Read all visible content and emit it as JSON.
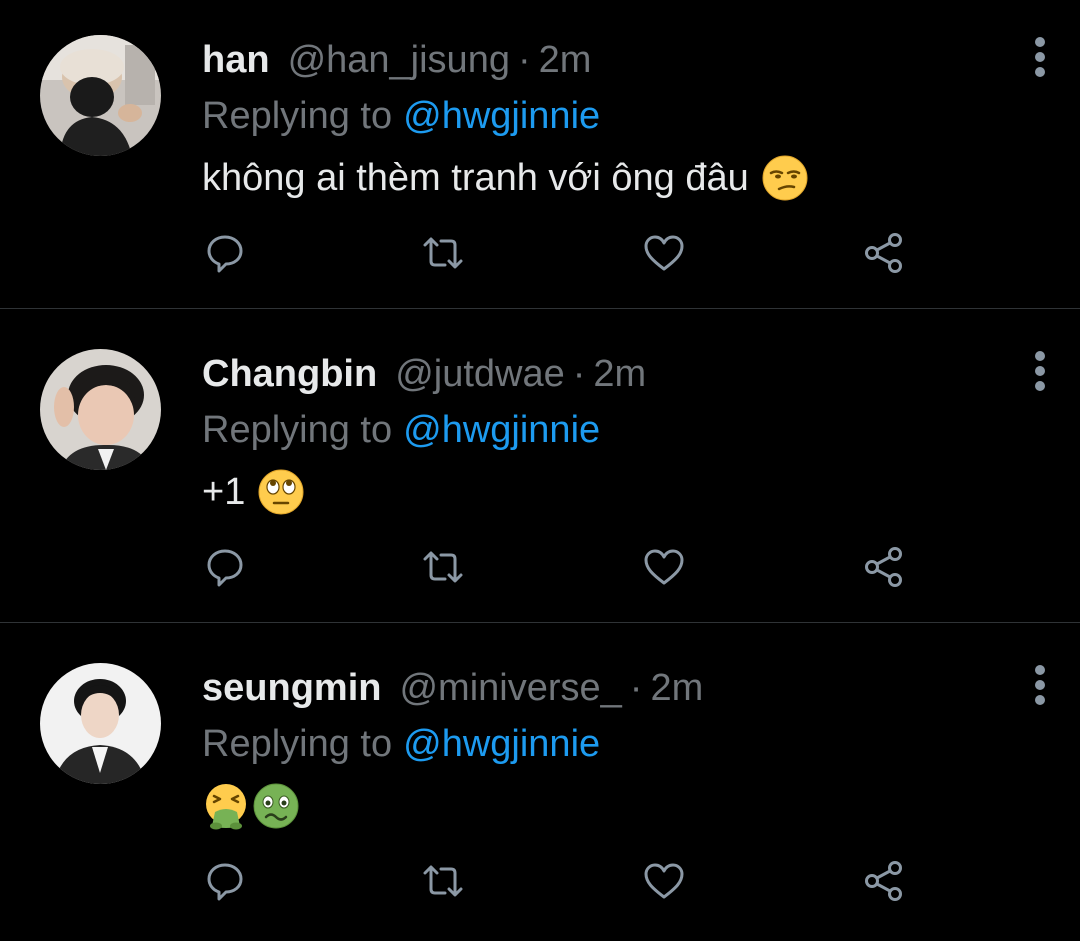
{
  "colors": {
    "background": "#000000",
    "divider": "#2f3336",
    "name": "#e7e9ea",
    "muted": "#71767b",
    "mention": "#1d9bf0",
    "icon": "#8b98a5"
  },
  "tweets": [
    {
      "name": "han",
      "handle": "@han_jisung",
      "separator": "·",
      "time": "2m",
      "reply_prefix": "Replying to",
      "reply_mention": "@hwgjinnie",
      "text": "không ai thèm tranh với ông đâu",
      "emojis": [
        "unamused-face-emoji"
      ],
      "avatar": "avatar-photo-masked-person"
    },
    {
      "name": "Changbin",
      "handle": "@jutdwae",
      "separator": "·",
      "time": "2m",
      "reply_prefix": "Replying to",
      "reply_mention": "@hwgjinnie",
      "text": "+1",
      "emojis": [
        "face-with-rolling-eyes-emoji"
      ],
      "avatar": "avatar-photo-peace-sign"
    },
    {
      "name": "seungmin",
      "handle": "@miniverse_",
      "separator": "·",
      "time": "2m",
      "reply_prefix": "Replying to",
      "reply_mention": "@hwgjinnie",
      "text": "",
      "emojis": [
        "face-vomiting-emoji",
        "nauseated-face-emoji"
      ],
      "avatar": "avatar-photo-suit"
    }
  ],
  "action_icons": [
    "reply-icon",
    "retweet-icon",
    "like-icon",
    "share-icon"
  ],
  "more_icon": "more-vertical-icon"
}
